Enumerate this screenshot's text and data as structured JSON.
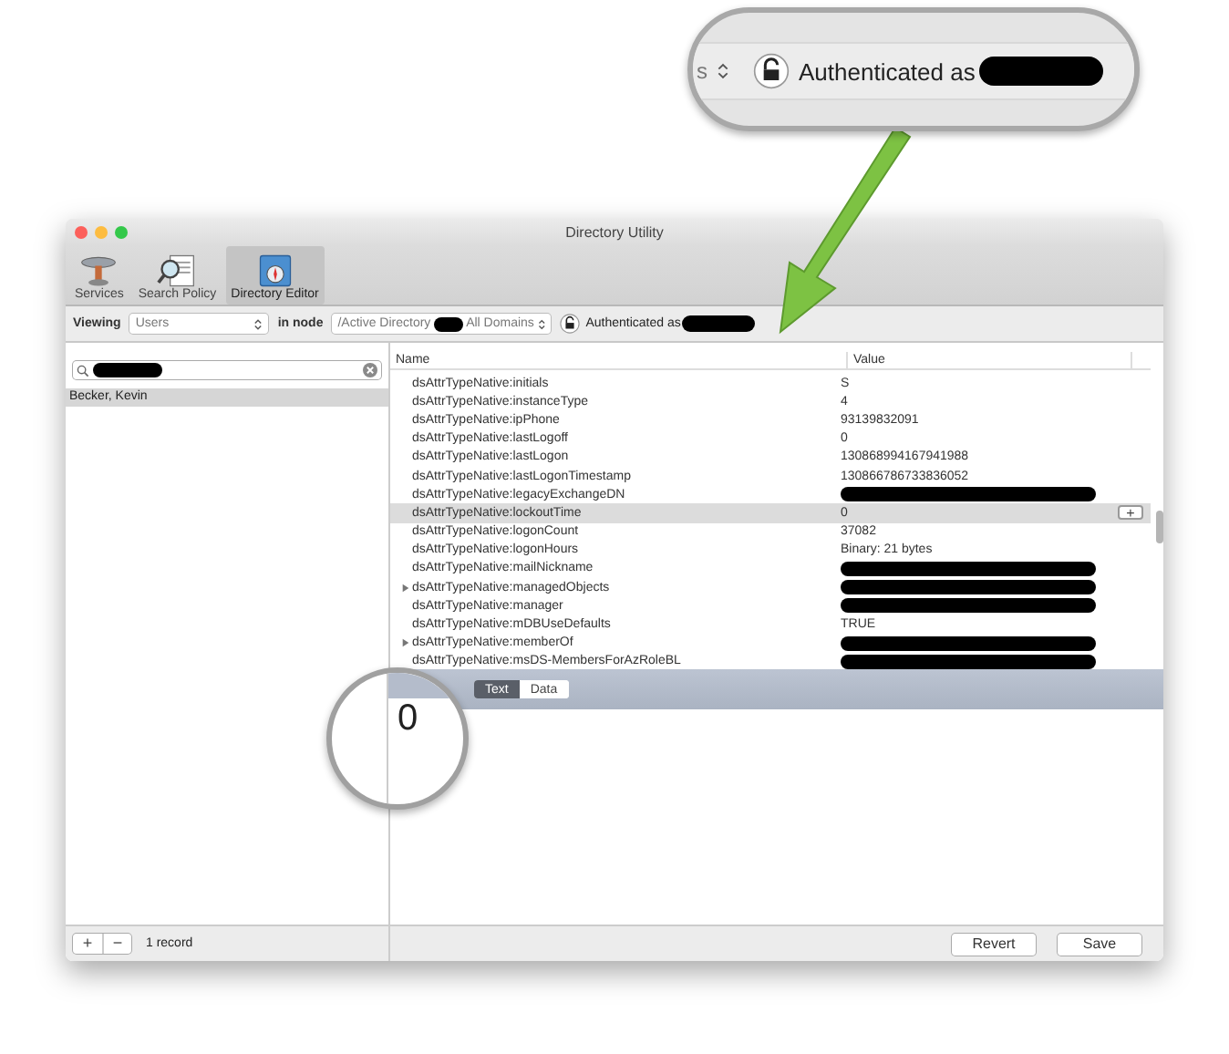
{
  "window": {
    "title": "Directory Utility"
  },
  "toolbar": [
    {
      "label": "Services",
      "selected": false
    },
    {
      "label": "Search Policy",
      "selected": false
    },
    {
      "label": "Directory Editor",
      "selected": true
    }
  ],
  "viewing_bar": {
    "viewing_label": "Viewing",
    "record_type": "Users",
    "node_label": "in node",
    "node_path_start": "/Active Directory",
    "node_path_end": "All Domains",
    "auth_text": "Authenticated as"
  },
  "sidebar": {
    "records": [
      {
        "name": "Becker, Kevin",
        "selected": true
      }
    ],
    "record_count": "1 record",
    "add_symbol": "+",
    "remove_symbol": "−"
  },
  "table": {
    "columns": [
      "Name",
      "Value"
    ],
    "rows": [
      {
        "name": "dsAttrTypeNative:initials",
        "value": "S",
        "redacted": false,
        "expandable": false,
        "selected": false
      },
      {
        "name": "dsAttrTypeNative:instanceType",
        "value": "4",
        "redacted": false,
        "expandable": false,
        "selected": false
      },
      {
        "name": "dsAttrTypeNative:ipPhone",
        "value": "93139832091",
        "redacted": false,
        "expandable": false,
        "selected": false
      },
      {
        "name": "dsAttrTypeNative:lastLogoff",
        "value": "0",
        "redacted": false,
        "expandable": false,
        "selected": false
      },
      {
        "name": "dsAttrTypeNative:lastLogon",
        "value": "130868994167941988",
        "redacted": false,
        "expandable": false,
        "selected": false
      },
      {
        "name": "dsAttrTypeNative:lastLogonTimestamp",
        "value": "130866786733836052",
        "redacted": false,
        "expandable": false,
        "selected": false
      },
      {
        "name": "dsAttrTypeNative:legacyExchangeDN",
        "redacted": true,
        "expandable": false,
        "selected": false
      },
      {
        "name": "dsAttrTypeNative:lockoutTime",
        "value": "0",
        "redacted": false,
        "expandable": false,
        "selected": true
      },
      {
        "name": "dsAttrTypeNative:logonCount",
        "value": "37082",
        "redacted": false,
        "expandable": false,
        "selected": false
      },
      {
        "name": "dsAttrTypeNative:logonHours",
        "value": "Binary: 21 bytes",
        "redacted": false,
        "expandable": false,
        "selected": false
      },
      {
        "name": "dsAttrTypeNative:mailNickname",
        "redacted": true,
        "expandable": false,
        "selected": false
      },
      {
        "name": "dsAttrTypeNative:managedObjects",
        "redacted": true,
        "expandable": true,
        "selected": false
      },
      {
        "name": "dsAttrTypeNative:manager",
        "redacted": true,
        "expandable": false,
        "selected": false
      },
      {
        "name": "dsAttrTypeNative:mDBUseDefaults",
        "value": "TRUE",
        "redacted": false,
        "expandable": false,
        "selected": false
      },
      {
        "name": "dsAttrTypeNative:memberOf",
        "redacted": true,
        "expandable": true,
        "selected": false
      },
      {
        "name": "dsAttrTypeNative:msDS-MembersForAzRoleBL",
        "redacted": true,
        "expandable": false,
        "selected": false
      }
    ],
    "add_value_symbol": "+"
  },
  "editor": {
    "modes": [
      {
        "label": "Text",
        "selected": true
      },
      {
        "label": "Data",
        "selected": false
      }
    ]
  },
  "buttons": [
    "Revert",
    "Save"
  ],
  "callout_top": {
    "stepper_fragment": "s",
    "auth_text": "Authenticated as"
  },
  "callout_lens": {
    "zoomed_value": "0"
  }
}
